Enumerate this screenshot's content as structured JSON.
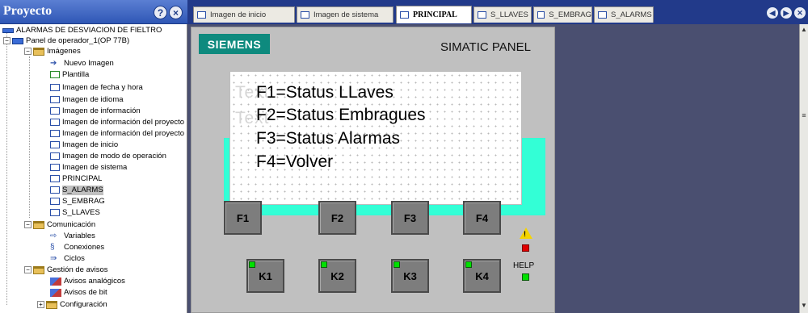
{
  "project_panel": {
    "title": "Proyecto",
    "help_icon_label": "?",
    "close_icon_label": "×",
    "tree": [
      {
        "label": "ALARMAS DE DESVIACION DE FIELTRO",
        "icon": "project-icon"
      },
      {
        "label": "Panel de operador_1(OP 77B)",
        "icon": "panel-icon"
      },
      {
        "label": "Imágenes",
        "icon": "folder-icon"
      },
      {
        "label": "Nuevo Imagen",
        "icon": "new-item-icon"
      },
      {
        "label": "Plantilla",
        "icon": "template-icon"
      },
      {
        "label": "Imagen de fecha y hora",
        "icon": "screen-icon"
      },
      {
        "label": "Imagen de idioma",
        "icon": "screen-icon"
      },
      {
        "label": "Imagen de información",
        "icon": "screen-icon"
      },
      {
        "label": "Imagen de información del proyecto",
        "icon": "screen-icon"
      },
      {
        "label": "Imagen de información del proyecto",
        "icon": "screen-icon"
      },
      {
        "label": "Imagen de inicio",
        "icon": "screen-icon"
      },
      {
        "label": "Imagen de modo de operación",
        "icon": "screen-icon"
      },
      {
        "label": "Imagen de sistema",
        "icon": "screen-icon"
      },
      {
        "label": "PRINCIPAL",
        "icon": "screen-icon"
      },
      {
        "label": "S_ALARMS",
        "icon": "screen-icon",
        "selected": true
      },
      {
        "label": "S_EMBRAG",
        "icon": "screen-icon"
      },
      {
        "label": "S_LLAVES",
        "icon": "screen-icon"
      },
      {
        "label": "Comunicación",
        "icon": "folder-icon"
      },
      {
        "label": "Variables",
        "icon": "variables-icon"
      },
      {
        "label": "Conexiones",
        "icon": "connections-icon"
      },
      {
        "label": "Ciclos",
        "icon": "cycles-icon"
      },
      {
        "label": "Gestión de avisos",
        "icon": "folder-icon"
      },
      {
        "label": "Avisos analógicos",
        "icon": "alarm-icon"
      },
      {
        "label": "Avisos de bit",
        "icon": "alarm-icon"
      },
      {
        "label": "Configuración",
        "icon": "folder-icon"
      }
    ]
  },
  "tabs": [
    {
      "label": "Imagen de inicio",
      "active": false
    },
    {
      "label": "Imagen de sistema",
      "active": false
    },
    {
      "label": "PRINCIPAL",
      "active": true
    },
    {
      "label": "S_LLAVES",
      "active": false
    },
    {
      "label": "S_EMBRAG",
      "active": false
    },
    {
      "label": "S_ALARMS",
      "active": false
    }
  ],
  "device": {
    "brand": "SIEMENS",
    "model_label": "SIMATIC PANEL",
    "screen_lines": [
      "F1=Status LLaves",
      "F2=Status Embragues",
      "F3=Status Alarmas",
      "F4=Volver"
    ],
    "ghost_texts": [
      "Text",
      "Text"
    ],
    "function_keys": [
      "F1",
      "F2",
      "F3",
      "F4"
    ],
    "k_keys": [
      "K1",
      "K2",
      "K3",
      "K4"
    ],
    "warning_mark": "!",
    "help_label": "HELP"
  },
  "colors": {
    "header_blue": "#2f57b5",
    "siemens_teal": "#0e8a7e",
    "screen_band_cyan": "#33ffd6",
    "workspace_bg": "#4a4f70",
    "led_green": "#00e000",
    "led_red": "#e00000"
  }
}
